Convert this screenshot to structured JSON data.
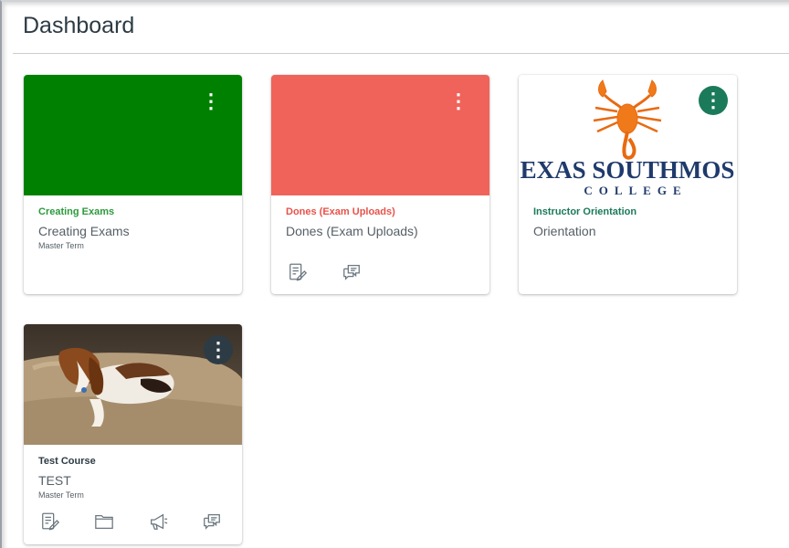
{
  "page": {
    "title": "Dashboard"
  },
  "cards": [
    {
      "code": "Creating Exams",
      "name": "Creating Exams",
      "term": "Master Term",
      "color": "#008000",
      "icons": []
    },
    {
      "code": "Dones (Exam Uploads)",
      "name": "Dones (Exam Uploads)",
      "term": "",
      "color": "#f0635a",
      "icons": [
        "assignments-icon",
        "discussions-icon"
      ]
    },
    {
      "code": "Instructor Orientation",
      "name": "Orientation",
      "term": "",
      "color": "#1b7a5a",
      "logo": {
        "line1": "EXAS SOUTHMOS",
        "line2": "COLLEGE"
      },
      "icons": []
    },
    {
      "code": "Test Course",
      "name": "TEST",
      "term": "Master Term",
      "color": "#2d3b45",
      "icons": [
        "assignments-icon",
        "files-icon",
        "announcements-icon",
        "discussions-icon"
      ]
    }
  ],
  "colors": {
    "text": "#2d3b45",
    "muted": "#555f66",
    "rule": "#c7cdd1"
  }
}
